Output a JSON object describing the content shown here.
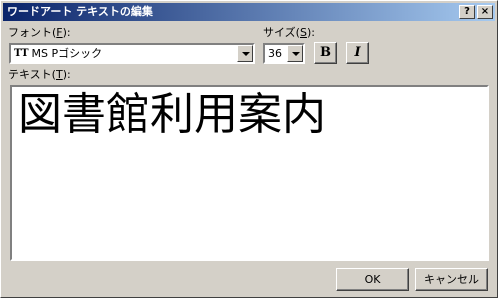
{
  "window": {
    "title": "ワードアート テキストの編集",
    "help_button": "?",
    "close_button": "×"
  },
  "font": {
    "label_main": "フォント(",
    "label_key": "F",
    "label_end": "):",
    "value": "MS Pゴシック",
    "type_icon": "truetype-font-icon"
  },
  "size": {
    "label_main": "サイズ(",
    "label_key": "S",
    "label_end": "):",
    "value": "36"
  },
  "style_buttons": {
    "bold": "B",
    "italic": "I"
  },
  "text_area": {
    "label_main": "テキスト(",
    "label_key": "T",
    "label_end": "):",
    "value": "図書館利用案内"
  },
  "buttons": {
    "ok": "OK",
    "cancel": "キャンセル"
  },
  "colors": {
    "titlebar_start": "#0a246a",
    "titlebar_end": "#a6caf0",
    "dialog_bg": "#d4d0c8"
  }
}
